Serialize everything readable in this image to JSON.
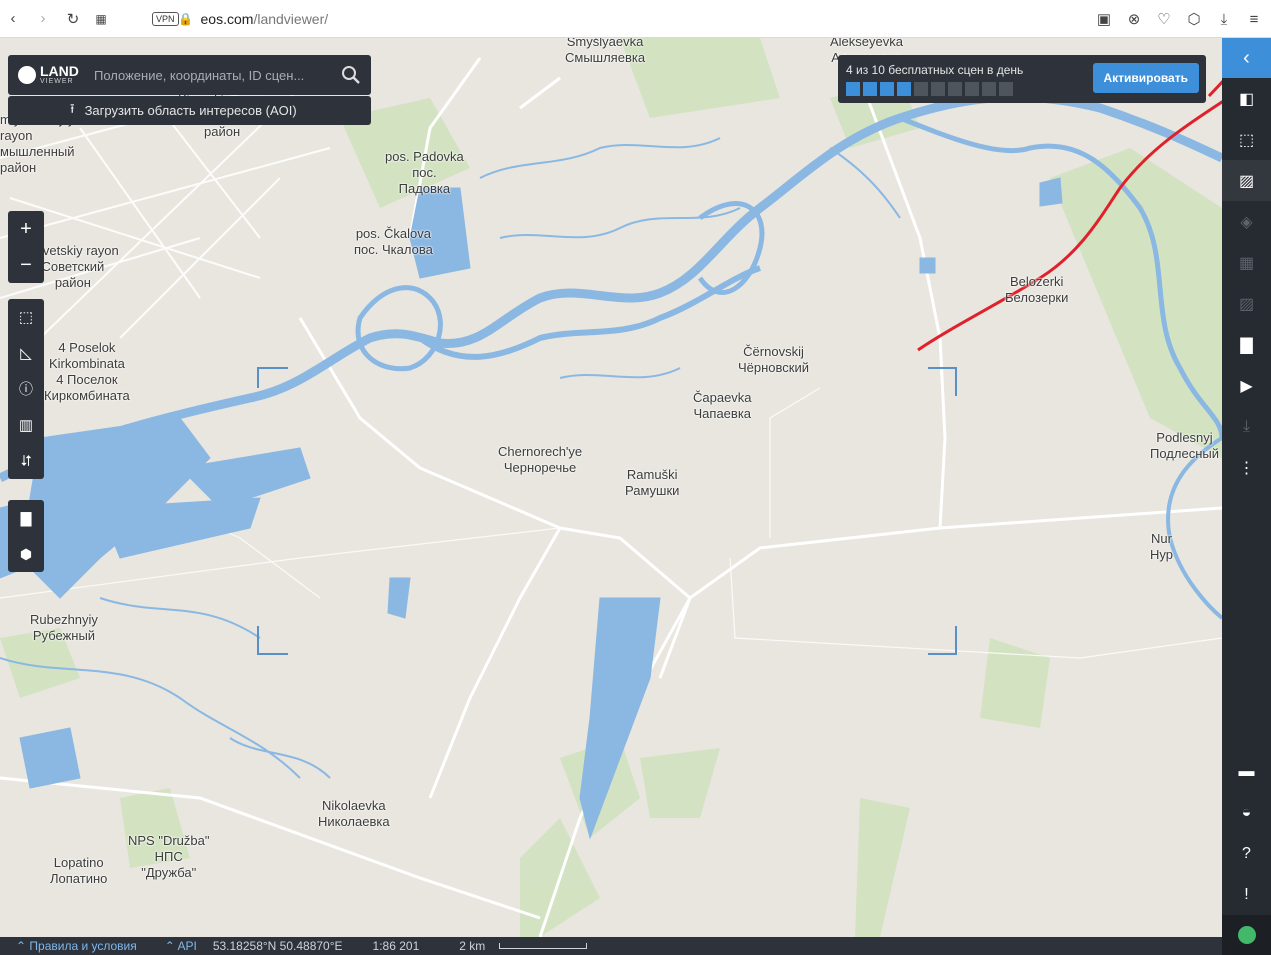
{
  "browser": {
    "vpn_label": "VPN",
    "url_domain": "eos.com",
    "url_path": "/landviewer/"
  },
  "app": {
    "logo_title": "LAND",
    "logo_sub": "VIEWER",
    "search_placeholder": "Положение, координаты, ID сцен...",
    "aoi_label": "Загрузить область интересов (AOI)"
  },
  "scenes": {
    "text": "4 из 10 бесплатных сцен в день",
    "used": 4,
    "total": 10,
    "activate_label": "Активировать"
  },
  "map_labels": [
    {
      "text": "Smyšlyaevka\nСмышляевка"
    },
    {
      "text": "Alekseyevka\nАлексеевка"
    },
    {
      "text": "Kirovskiy rayon\nКировский\nрайон"
    },
    {
      "text": "mlyshlennyiy\nrayon\nмышленный\nрайон"
    },
    {
      "text": "pos. Padovka\nпос.\nПадовка"
    },
    {
      "text": "pos. Čkalova\nпос. Чкалова"
    },
    {
      "text": "Sovetskiy rayon\nСоветский\nрайон"
    },
    {
      "text": "Belozerki\nБелозерки"
    },
    {
      "text": "Čërnovskij\nЧёрновский"
    },
    {
      "text": "Čapaevka\nЧапаевка"
    },
    {
      "text": "4 Poselok\nKirkombinata\n4 Поселок\nКиркомбината"
    },
    {
      "text": "Chernorech'ye\nЧерноречье"
    },
    {
      "text": "Ramuški\nРамушки"
    },
    {
      "text": "Podlesnyj\nПодлесный"
    },
    {
      "text": "Nur\nНур"
    },
    {
      "text": "Rubezhnyiy\nРубежный"
    },
    {
      "text": "Nikolaevka\nНиколаевка"
    },
    {
      "text": "NPS \"Družba\"\nНПС\n\"Дружба\""
    },
    {
      "text": "Lopatino\nЛопатино"
    }
  ],
  "status": {
    "terms": "Правила и условия",
    "api": "API",
    "coords": "53.18258°N 50.48870°E",
    "scale_ratio": "1:86 201",
    "scale_km": "2 km"
  },
  "colors": {
    "water": "#8ab8e3",
    "land": "#e8e6df",
    "green": "#cfe2bd",
    "panel": "#2e333b",
    "accent": "#3d8fd9",
    "annotation": "#e0202a"
  }
}
